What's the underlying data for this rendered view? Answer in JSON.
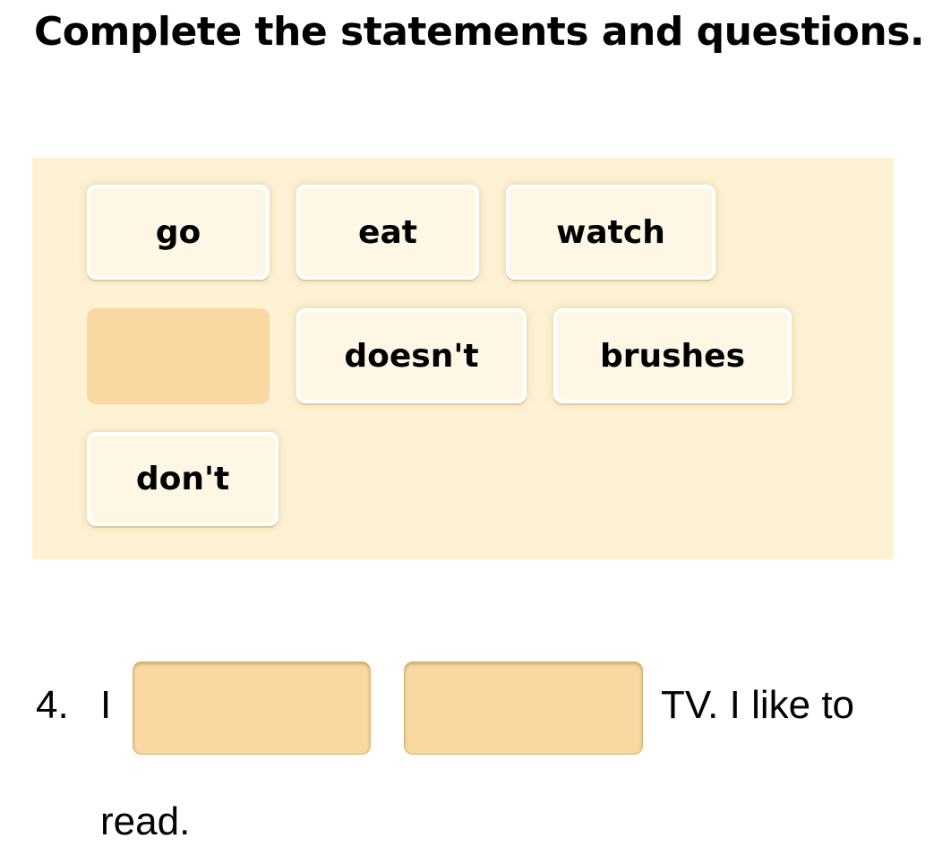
{
  "instruction": "Complete the statements and questions.",
  "word_bank": {
    "tiles": [
      {
        "label": "go"
      },
      {
        "label": "eat"
      },
      {
        "label": "watch"
      },
      {
        "label": ""
      },
      {
        "label": "doesn't"
      },
      {
        "label": "brushes"
      },
      {
        "label": "don't"
      }
    ],
    "empty_slot_note": "tile moved to answer"
  },
  "question": {
    "number": "4.",
    "subject": "I",
    "blanks": [
      "",
      ""
    ],
    "after_blanks": "TV. I like to",
    "continuation": "read."
  },
  "colors": {
    "bank_background": "#fdf2d3",
    "tile_background": "#fef7e5",
    "blank_fill": "#f9d9a1"
  }
}
